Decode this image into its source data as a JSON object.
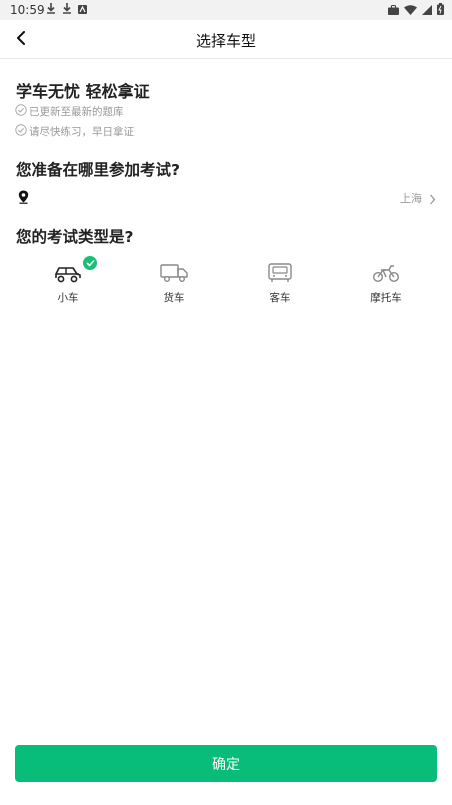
{
  "status_bar": {
    "time": "10:59",
    "left_icons": [
      "download-icon",
      "download-icon",
      "app-notification-icon"
    ],
    "right_icons": [
      "briefcase-icon",
      "wifi-icon",
      "signal-icon",
      "battery-icon"
    ]
  },
  "nav": {
    "title": "选择车型",
    "back_icon": "chevron-left-icon"
  },
  "intro": {
    "slogan": "学车无忧 轻松拿证",
    "tips": [
      "已更新至最新的题库",
      "请尽快练习，早日拿证"
    ]
  },
  "location": {
    "question": "您准备在哪里参加考试?",
    "city": "上海"
  },
  "exam_type": {
    "question": "您的考试类型是?",
    "options": [
      {
        "label": "小车",
        "icon": "car-icon",
        "selected": true
      },
      {
        "label": "货车",
        "icon": "truck-icon",
        "selected": false
      },
      {
        "label": "客车",
        "icon": "bus-icon",
        "selected": false
      },
      {
        "label": "摩托车",
        "icon": "motorcycle-icon",
        "selected": false
      }
    ]
  },
  "confirm": {
    "label": "确定"
  },
  "colors": {
    "accent": "#07bd79",
    "check": "#1bbf74",
    "muted_text": "#999999"
  }
}
